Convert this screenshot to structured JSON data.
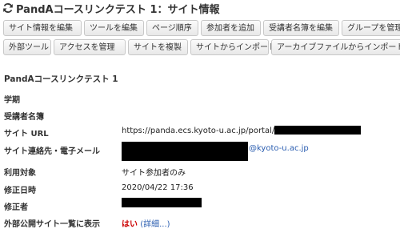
{
  "header": {
    "title": "PandAコースリンクテスト 1：サイト情報"
  },
  "toolbar_row1": [
    "サイト情報を編集",
    "ツールを編集",
    "ページ順序",
    "参加者を追加",
    "受講者名簿を編集",
    "グループを管理"
  ],
  "toolbar_row2": [
    "外部ツール",
    "アクセスを管理",
    "サイトを複製",
    "サイトからインポート",
    "アーカイブファイルからインポート"
  ],
  "site": {
    "name": "PandAコースリンクテスト 1"
  },
  "fields": {
    "term": {
      "label": "学期",
      "value": ""
    },
    "roster": {
      "label": "受講者名簿",
      "value": ""
    },
    "url": {
      "label": "サイト URL",
      "value": "https://panda.ecs.kyoto-u.ac.jp/portal/site/"
    },
    "contact": {
      "label": "サイト連絡先・電子メール",
      "email_suffix": "@kyoto-u.ac.jp"
    },
    "audience": {
      "label": "利用対象",
      "value": "サイト参加者のみ"
    },
    "modified_date": {
      "label": "修正日時",
      "value": "2020/04/22 17:36"
    },
    "modified_by": {
      "label": "修正者",
      "value": ""
    },
    "public_listing": {
      "label": "外部公開サイト一覧に表示",
      "value": "はい",
      "detail": "(詳細...)"
    }
  },
  "colors": {
    "link": "#2a5db0",
    "yes": "#cc0000",
    "redaction": "#000000"
  },
  "icons": {
    "header": "refresh-icon"
  }
}
